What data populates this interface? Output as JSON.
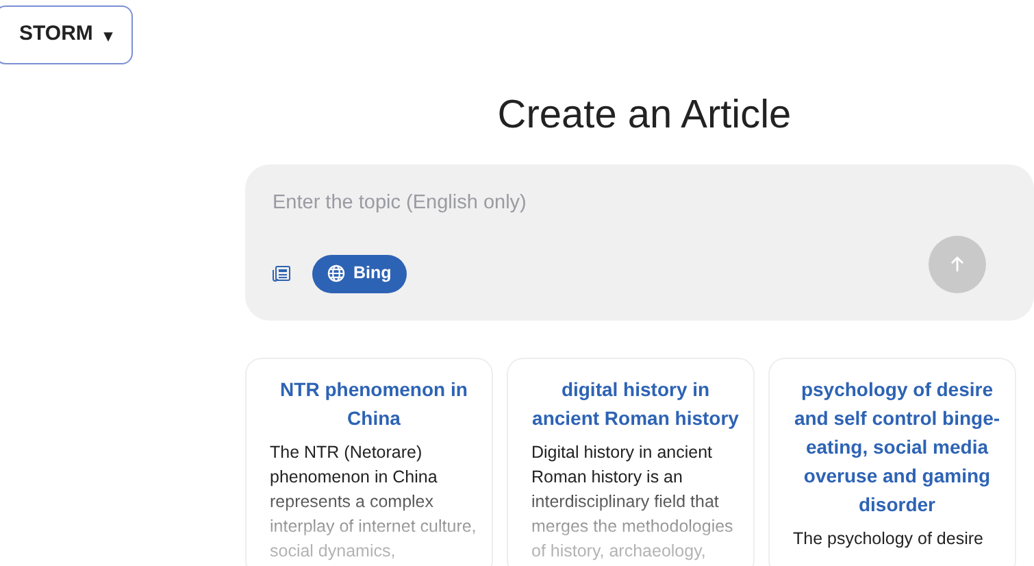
{
  "app_menu": {
    "label": "STORM",
    "caret": "▾"
  },
  "heading": "Create an Article",
  "topic_input": {
    "placeholder": "Enter the topic (English only)"
  },
  "search_engine": {
    "label": "Bing",
    "selected": true
  },
  "submit": {
    "disabled": true
  },
  "articles": [
    {
      "title": "NTR phenomenon in China",
      "summary": "The NTR (Netorare) phenomenon in China represents a complex interplay of internet culture, social dynamics,"
    },
    {
      "title": "digital history in ancient Roman history",
      "summary": "Digital history in ancient Roman history is an interdisciplinary field that merges the methodologies of history, archaeology,"
    },
    {
      "title": "psychology of desire and self control binge-eating, social media overuse and gaming disorder",
      "summary": "The psychology of desire"
    }
  ]
}
